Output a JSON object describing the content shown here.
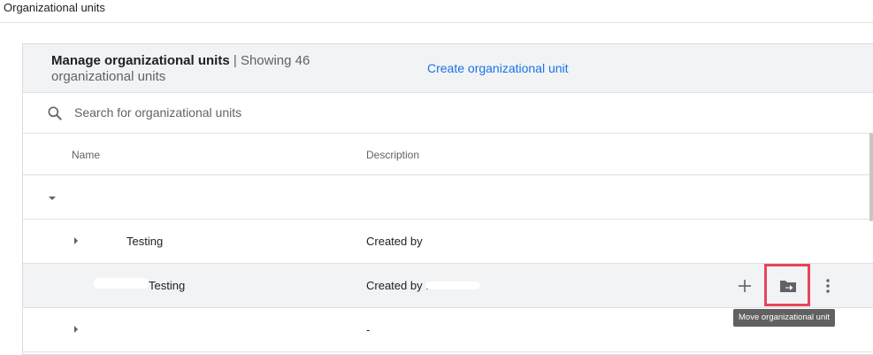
{
  "page": {
    "title": "Organizational units"
  },
  "card": {
    "title": "Manage organizational units",
    "separator": "|",
    "count_prefix": "Showing 46",
    "count_suffix": "organizational units",
    "create_link": "Create organizational unit"
  },
  "search": {
    "placeholder": "Search for organizational units",
    "value": ""
  },
  "table": {
    "columns": {
      "name": "Name",
      "description": "Description"
    },
    "rows": [
      {
        "name": "",
        "description": "",
        "expanded": true
      },
      {
        "name": "Testing",
        "description": "Created by",
        "expanded": false
      },
      {
        "name": "Testing",
        "description": "Created by .",
        "expanded": null
      },
      {
        "name": "",
        "description": "-",
        "expanded": false
      }
    ]
  },
  "actions": {
    "add_icon": "plus-icon",
    "move_icon": "folder-move-icon",
    "more_icon": "more-vert-icon"
  },
  "tooltip": {
    "text": "Move organizational unit"
  },
  "colors": {
    "accent": "#1a73e8",
    "highlight": "#e8455a",
    "header_bg": "#f1f3f4"
  }
}
